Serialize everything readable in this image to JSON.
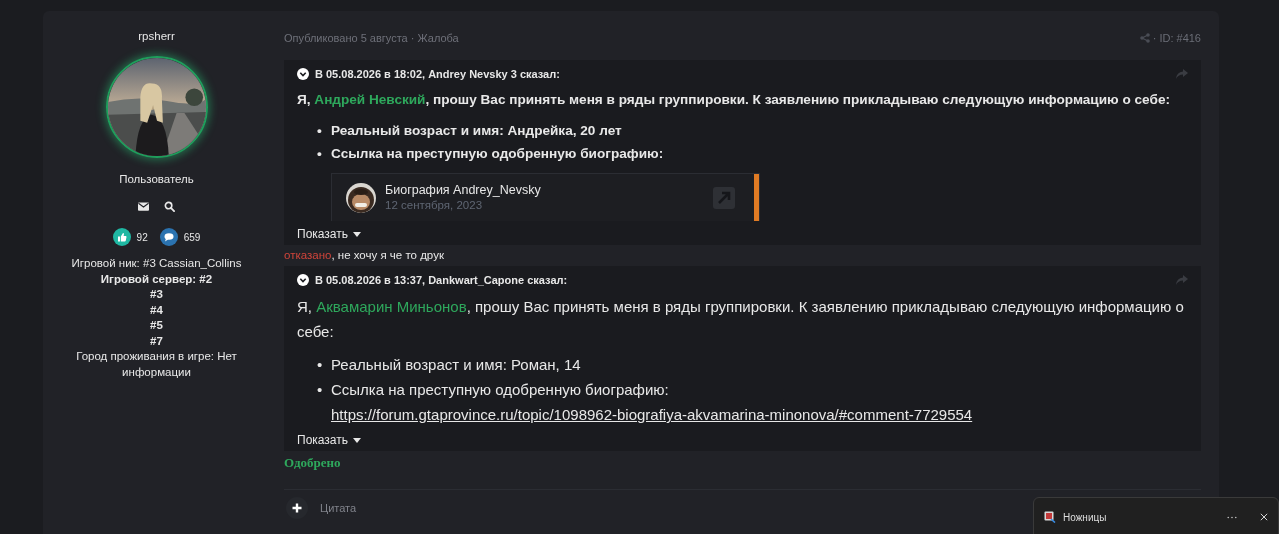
{
  "author": {
    "name": "rpsherr",
    "role": "Пользователь",
    "stats": [
      {
        "kind": "likes",
        "count": "92"
      },
      {
        "kind": "posts",
        "count": "659"
      }
    ],
    "fields": [
      {
        "text": "Игровой ник: #3 Cassian_Collins",
        "bold": false
      },
      {
        "text": "Игровой сервер: #2",
        "bold": true
      },
      {
        "text": "#3",
        "bold": true
      },
      {
        "text": "#4",
        "bold": true
      },
      {
        "text": "#5",
        "bold": true
      },
      {
        "text": "#7",
        "bold": true
      },
      {
        "text": "Город проживания в игре: Нет информации",
        "bold": false
      }
    ]
  },
  "post": {
    "meta": "Опубликовано 5 августа · Жалоба",
    "post_id": "· ID: #416",
    "blocks": [
      {
        "kind": "quote",
        "header": "В 05.08.2026 в 18:02, Andrey Nevsky 3 сказал:",
        "bold": true,
        "paragraph": [
          {
            "text": "Я, "
          },
          {
            "text": "Андрей Невский",
            "kind": "mention"
          },
          {
            "text": ", прошу Вас принять меня в ряды группировки. К заявлению прикладываю следующую информацию о себе:"
          }
        ],
        "bullets": [
          {
            "marker": "•",
            "parts": [
              {
                "text": "Реальный возраст и имя: Андрейка, 20 лет"
              }
            ]
          },
          {
            "marker": "•",
            "parts": [
              {
                "text": "Ссылка на преступную одобренную биографию:"
              }
            ]
          }
        ],
        "embed": {
          "title": "Биография Andrey_Nevsky",
          "date": "12 сентября, 2023"
        },
        "expand": "Показать"
      },
      {
        "kind": "text",
        "parts": [
          {
            "text": "отказано",
            "kind": "refusal"
          },
          {
            "text": ", не хочу я че то друк"
          }
        ]
      },
      {
        "kind": "quote",
        "header": "В 05.08.2026 в 13:37, Dankwart_Capone сказал:",
        "bold": false,
        "paragraph": [
          {
            "text": "Я, "
          },
          {
            "text": "Аквамарин Миньонов",
            "kind": "mention"
          },
          {
            "text": ", прошу Вас принять меня в ряды группировки. К заявлению прикладываю следующую информацию о себе:"
          }
        ],
        "bullets": [
          {
            "marker": "•",
            "parts": [
              {
                "text": "Реальный возраст и имя: Роман, 14"
              }
            ]
          },
          {
            "marker": "•",
            "parts": [
              {
                "text": "Ссылка на преступную одобренную биографию:"
              },
              {
                "text": "https://forum.gtaprovince.ru/topic/1098962-biografiya-akvamarina-minonova/#comment-7729554",
                "kind": "link"
              }
            ]
          }
        ],
        "expand": "Показать"
      },
      {
        "kind": "status",
        "text": "Одобрено"
      }
    ]
  },
  "reply": {
    "label": "Цитата"
  },
  "toast": {
    "app": "Ножницы"
  }
}
